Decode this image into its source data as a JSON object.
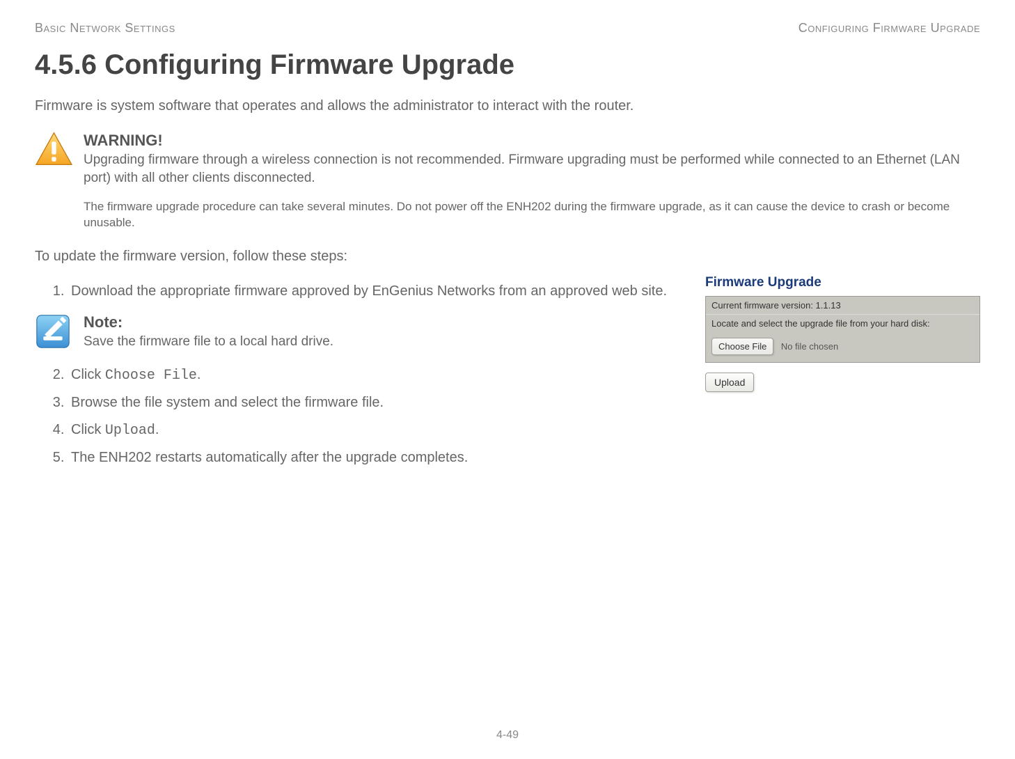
{
  "header": {
    "left": "Basic Network Settings",
    "right": "Configuring Firmware Upgrade"
  },
  "title": "4.5.6 Configuring Firmware Upgrade",
  "intro": "Firmware is system software that operates and allows the administrator to interact with the router.",
  "warning": {
    "title": "WARNING!",
    "text": "Upgrading firmware through a wireless connection is not recommended. Firmware upgrading must be performed while connected to an Ethernet (LAN port) with all other clients disconnected.",
    "text2": "The firmware upgrade procedure can take several minutes. Do not power off the ENH202 during the firmware upgrade, as it can cause the device to crash or become unusable."
  },
  "instruction": "To update the firmware version, follow these steps:",
  "steps": {
    "s1": "Download the appropriate firmware approved by EnGenius Networks from an approved web site.",
    "s2a": "Click ",
    "s2b": "Choose File",
    "s2c": ".",
    "s3": "Browse the file system and select the firmware file.",
    "s4a": "Click ",
    "s4b": "Upload",
    "s4c": ".",
    "s5": "The ENH202 restarts automatically after the upgrade completes."
  },
  "note": {
    "title": "Note:",
    "text": "Save the firmware file to a local hard drive."
  },
  "panel": {
    "title": "Firmware Upgrade",
    "version_label": "Current firmware version: 1.1.13",
    "locate_label": "Locate and select the upgrade file from your hard disk:",
    "choose_file": "Choose File",
    "no_file": "No file chosen",
    "upload": "Upload"
  },
  "page_number": "4-49"
}
